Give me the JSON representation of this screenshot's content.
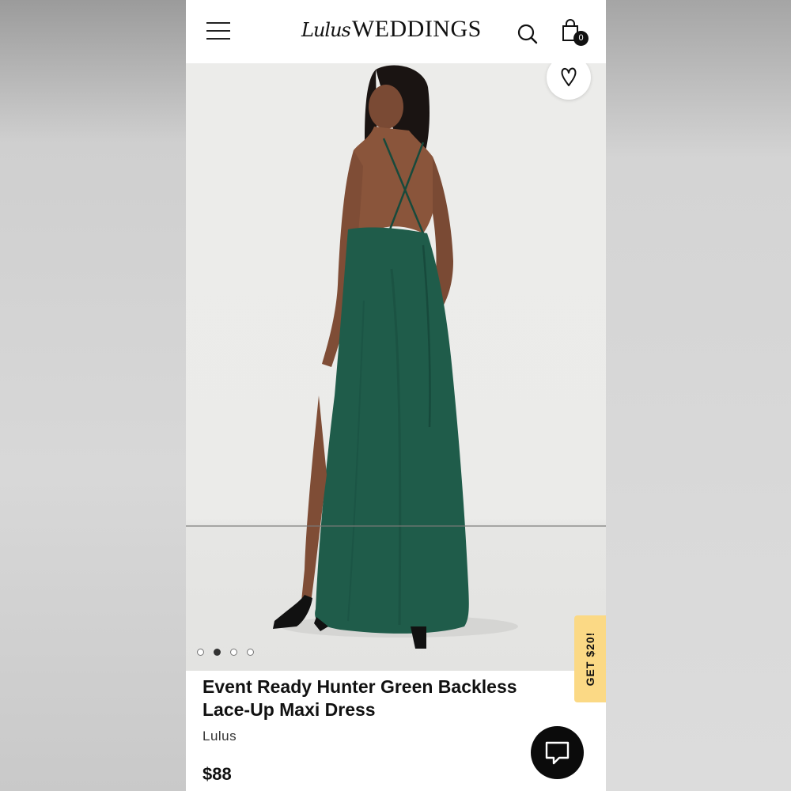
{
  "header": {
    "logo_script": "Lulus",
    "logo_main": "WEDDINGS",
    "cart_count": "0",
    "icons": {
      "menu": "hamburger-menu-icon",
      "search": "search-icon",
      "cart": "shopping-bag-icon"
    }
  },
  "gallery": {
    "image": "model-in-hunter-green-backless-maxi-dress",
    "dot_count": 4,
    "active_index": 1,
    "wishlist_icon": "heart-icon"
  },
  "promo": {
    "label": "GET $20!",
    "color": "#fbd985"
  },
  "product": {
    "title": "Event Ready Hunter Green Backless Lace-Up Maxi Dress",
    "brand": "Lulus",
    "price": "$88"
  },
  "chat": {
    "icon": "chat-bubble-icon"
  },
  "colors": {
    "dress": "#1f5c4a",
    "accent_dark": "#111111"
  }
}
